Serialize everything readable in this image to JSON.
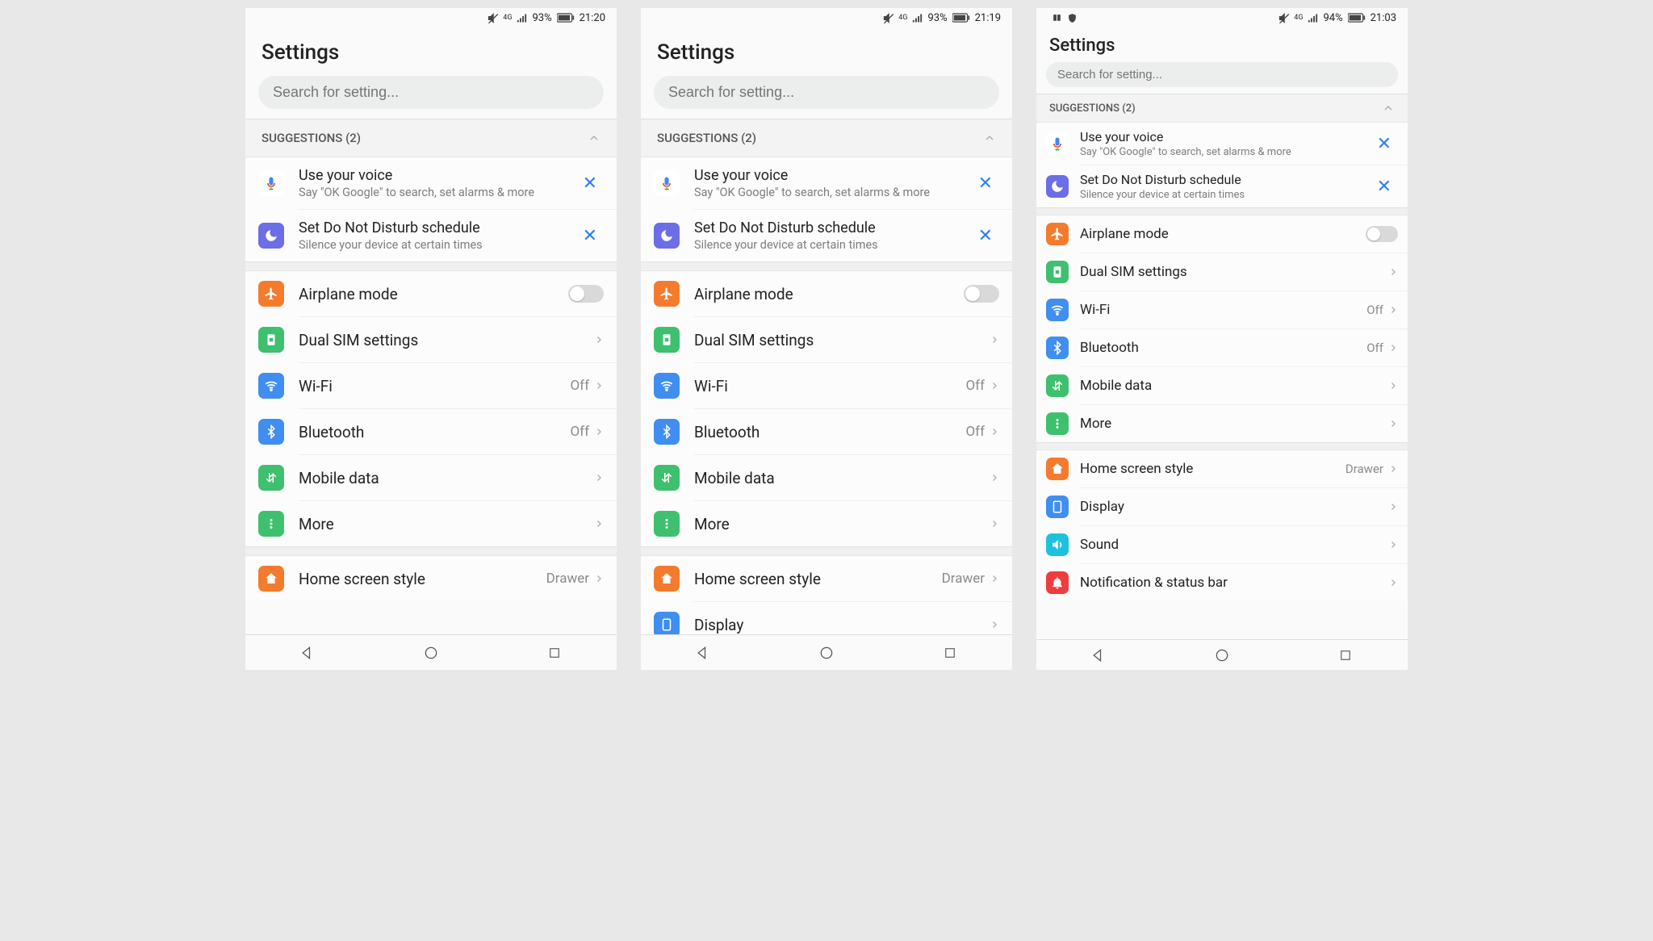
{
  "phones": [
    {
      "status": {
        "battery": "93%",
        "time": "21:20",
        "leftIcons": false
      },
      "title": "Settings",
      "searchPlaceholder": "Search for setting...",
      "suggestionsHeader": "SUGGESTIONS (2)",
      "suggestions": [
        {
          "icon": "mic",
          "title": "Use your voice",
          "sub": "Say \"OK Google\" to search, set alarms & more"
        },
        {
          "icon": "moon",
          "title": "Set Do Not Disturb schedule",
          "sub": "Silence your device at certain times"
        }
      ],
      "groups": [
        [
          {
            "icon": "airplane",
            "label": "Airplane mode",
            "control": "toggle"
          },
          {
            "icon": "sim",
            "label": "Dual SIM settings",
            "control": "chevron"
          },
          {
            "icon": "wifi",
            "label": "Wi-Fi",
            "value": "Off",
            "control": "chevron"
          },
          {
            "icon": "bluetooth",
            "label": "Bluetooth",
            "value": "Off",
            "control": "chevron"
          },
          {
            "icon": "mobiledata",
            "label": "Mobile data",
            "control": "chevron"
          },
          {
            "icon": "more",
            "label": "More",
            "control": "chevron"
          }
        ],
        [
          {
            "icon": "home",
            "label": "Home screen style",
            "value": "Drawer",
            "control": "chevron"
          }
        ]
      ]
    },
    {
      "status": {
        "battery": "93%",
        "time": "21:19",
        "leftIcons": false
      },
      "title": "Settings",
      "searchPlaceholder": "Search for setting...",
      "suggestionsHeader": "SUGGESTIONS (2)",
      "suggestions": [
        {
          "icon": "mic",
          "title": "Use your voice",
          "sub": "Say \"OK Google\" to search, set alarms & more"
        },
        {
          "icon": "moon",
          "title": "Set Do Not Disturb schedule",
          "sub": "Silence your device at certain times"
        }
      ],
      "groups": [
        [
          {
            "icon": "airplane",
            "label": "Airplane mode",
            "control": "toggle"
          },
          {
            "icon": "sim",
            "label": "Dual SIM settings",
            "control": "chevron"
          },
          {
            "icon": "wifi",
            "label": "Wi-Fi",
            "value": "Off",
            "control": "chevron"
          },
          {
            "icon": "bluetooth",
            "label": "Bluetooth",
            "value": "Off",
            "control": "chevron"
          },
          {
            "icon": "mobiledata",
            "label": "Mobile data",
            "control": "chevron"
          },
          {
            "icon": "more",
            "label": "More",
            "control": "chevron"
          }
        ],
        [
          {
            "icon": "home",
            "label": "Home screen style",
            "value": "Drawer",
            "control": "chevron"
          },
          {
            "icon": "display",
            "label": "Display",
            "control": "chevron"
          }
        ]
      ]
    },
    {
      "status": {
        "battery": "94%",
        "time": "21:03",
        "leftIcons": true
      },
      "title": "Settings",
      "searchPlaceholder": "Search for setting...",
      "suggestionsHeader": "SUGGESTIONS (2)",
      "suggestions": [
        {
          "icon": "mic",
          "title": "Use your voice",
          "sub": "Say \"OK Google\" to search, set alarms & more"
        },
        {
          "icon": "moon",
          "title": "Set Do Not Disturb schedule",
          "sub": "Silence your device at certain times"
        }
      ],
      "groups": [
        [
          {
            "icon": "airplane",
            "label": "Airplane mode",
            "control": "toggle"
          },
          {
            "icon": "sim",
            "label": "Dual SIM settings",
            "control": "chevron"
          },
          {
            "icon": "wifi",
            "label": "Wi-Fi",
            "value": "Off",
            "control": "chevron"
          },
          {
            "icon": "bluetooth",
            "label": "Bluetooth",
            "value": "Off",
            "control": "chevron"
          },
          {
            "icon": "mobiledata",
            "label": "Mobile data",
            "control": "chevron"
          },
          {
            "icon": "more",
            "label": "More",
            "control": "chevron"
          }
        ],
        [
          {
            "icon": "home",
            "label": "Home screen style",
            "value": "Drawer",
            "control": "chevron"
          },
          {
            "icon": "display",
            "label": "Display",
            "control": "chevron"
          },
          {
            "icon": "sound",
            "label": "Sound",
            "control": "chevron"
          },
          {
            "icon": "notif",
            "label": "Notification & status bar",
            "control": "chevron"
          }
        ]
      ]
    }
  ],
  "iconMeta": {
    "airplane": {
      "bg": "bg-orange"
    },
    "sim": {
      "bg": "bg-green"
    },
    "wifi": {
      "bg": "bg-blue"
    },
    "bluetooth": {
      "bg": "bg-blue"
    },
    "mobiledata": {
      "bg": "bg-green"
    },
    "more": {
      "bg": "bg-green"
    },
    "home": {
      "bg": "bg-orange"
    },
    "display": {
      "bg": "bg-blue"
    },
    "sound": {
      "bg": "bg-cyan"
    },
    "notif": {
      "bg": "bg-red"
    },
    "moon": {
      "bg": "bg-indigo"
    },
    "mic": {
      "bg": ""
    }
  }
}
